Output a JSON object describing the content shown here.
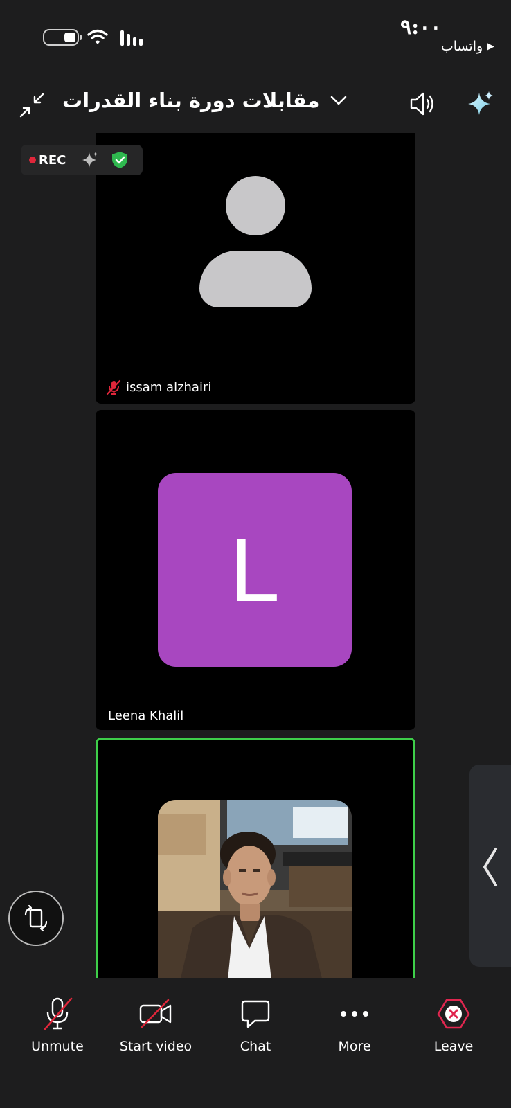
{
  "status_bar": {
    "time": "٩:٠٠",
    "back_app": "واتساب",
    "back_arrow": "▶"
  },
  "header": {
    "meeting_title": "مقابلات دورة بناء القدرات"
  },
  "recording": {
    "label": "REC",
    "rec_color": "#e0263a",
    "shield_color": "#2fb84f"
  },
  "participants": [
    {
      "name": "issam alzhairi",
      "muted": true,
      "avatar": "silhouette"
    },
    {
      "name": "Leena Khalil",
      "avatar_letter": "L",
      "avatar_color": "#a847c0"
    },
    {
      "name": "",
      "avatar": "photo",
      "active_speaker": true,
      "highlight_color": "#3ecf4a"
    }
  ],
  "toolbar": {
    "unmute": "Unmute",
    "start_video": "Start video",
    "chat": "Chat",
    "more": "More",
    "leave": "Leave",
    "leave_color": "#e0264f"
  }
}
